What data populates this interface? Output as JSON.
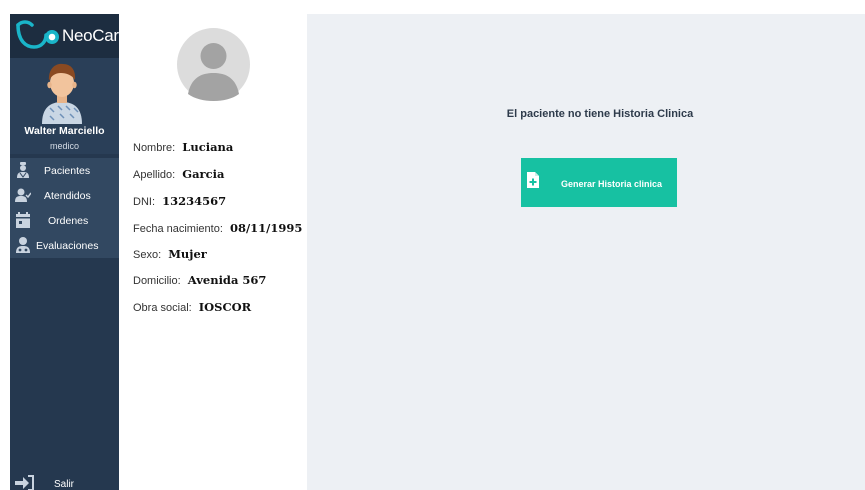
{
  "app": {
    "name": "NeoCare"
  },
  "user": {
    "name": "Walter Marciello",
    "role": "medico"
  },
  "nav": {
    "items": [
      {
        "label": "Pacientes",
        "icon": "patients-icon"
      },
      {
        "label": "Atendidos",
        "icon": "attended-icon"
      },
      {
        "label": "Ordenes",
        "icon": "calendar-icon"
      },
      {
        "label": "Evaluaciones",
        "icon": "evaluations-icon"
      }
    ],
    "logout": "Salir"
  },
  "patient": {
    "fields": [
      {
        "label": "Nombre:",
        "value": "Luciana"
      },
      {
        "label": "Apellido:",
        "value": "Garcia"
      },
      {
        "label": "DNI:",
        "value": "13234567"
      },
      {
        "label": "Fecha nacimiento:",
        "value": "08/11/1995"
      },
      {
        "label": "Sexo:",
        "value": "Mujer"
      },
      {
        "label": "Domicilio:",
        "value": "Avenida 567"
      },
      {
        "label": "Obra social:",
        "value": "IOSCOR"
      }
    ]
  },
  "main": {
    "empty_message": "El paciente no tiene Historia Clinica",
    "generate_button": "Generar Historia clinica"
  },
  "colors": {
    "sidebar": "#25384f",
    "accent": "#17c1a2",
    "logo_accent": "#1ab5c9",
    "main_bg": "#edf0f4"
  }
}
